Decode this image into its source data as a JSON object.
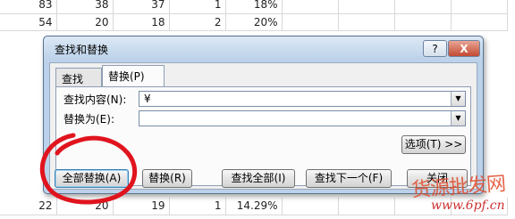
{
  "sheet": {
    "top_rows": [
      [
        "83",
        "38",
        "37",
        "1",
        "18%"
      ],
      [
        "54",
        "20",
        "18",
        "2",
        "20%"
      ]
    ],
    "bottom_rows": [
      [
        "22",
        "20",
        "19",
        "1",
        "14.29%"
      ]
    ]
  },
  "dialog": {
    "title": "查找和替换",
    "help_label": "?",
    "close_label": "X",
    "tabs": [
      {
        "label": "查找(D)"
      },
      {
        "label": "替换(P)"
      }
    ],
    "find_label": "查找内容(N):",
    "find_value": "¥",
    "replace_label": "替换为(E):",
    "replace_value": "",
    "options_button": "选项(T) >>",
    "buttons": {
      "replace_all": "全部替换(A)",
      "replace": "替换(R)",
      "find_all": "查找全部(I)",
      "find_next": "查找下一个(F)",
      "close": "关闭"
    }
  },
  "watermark": {
    "text": "货源批发网",
    "url": "www.6pf.cn"
  },
  "colors": {
    "dialog_frame": "#bcd2ea",
    "annotation_red": "#e0141e"
  }
}
